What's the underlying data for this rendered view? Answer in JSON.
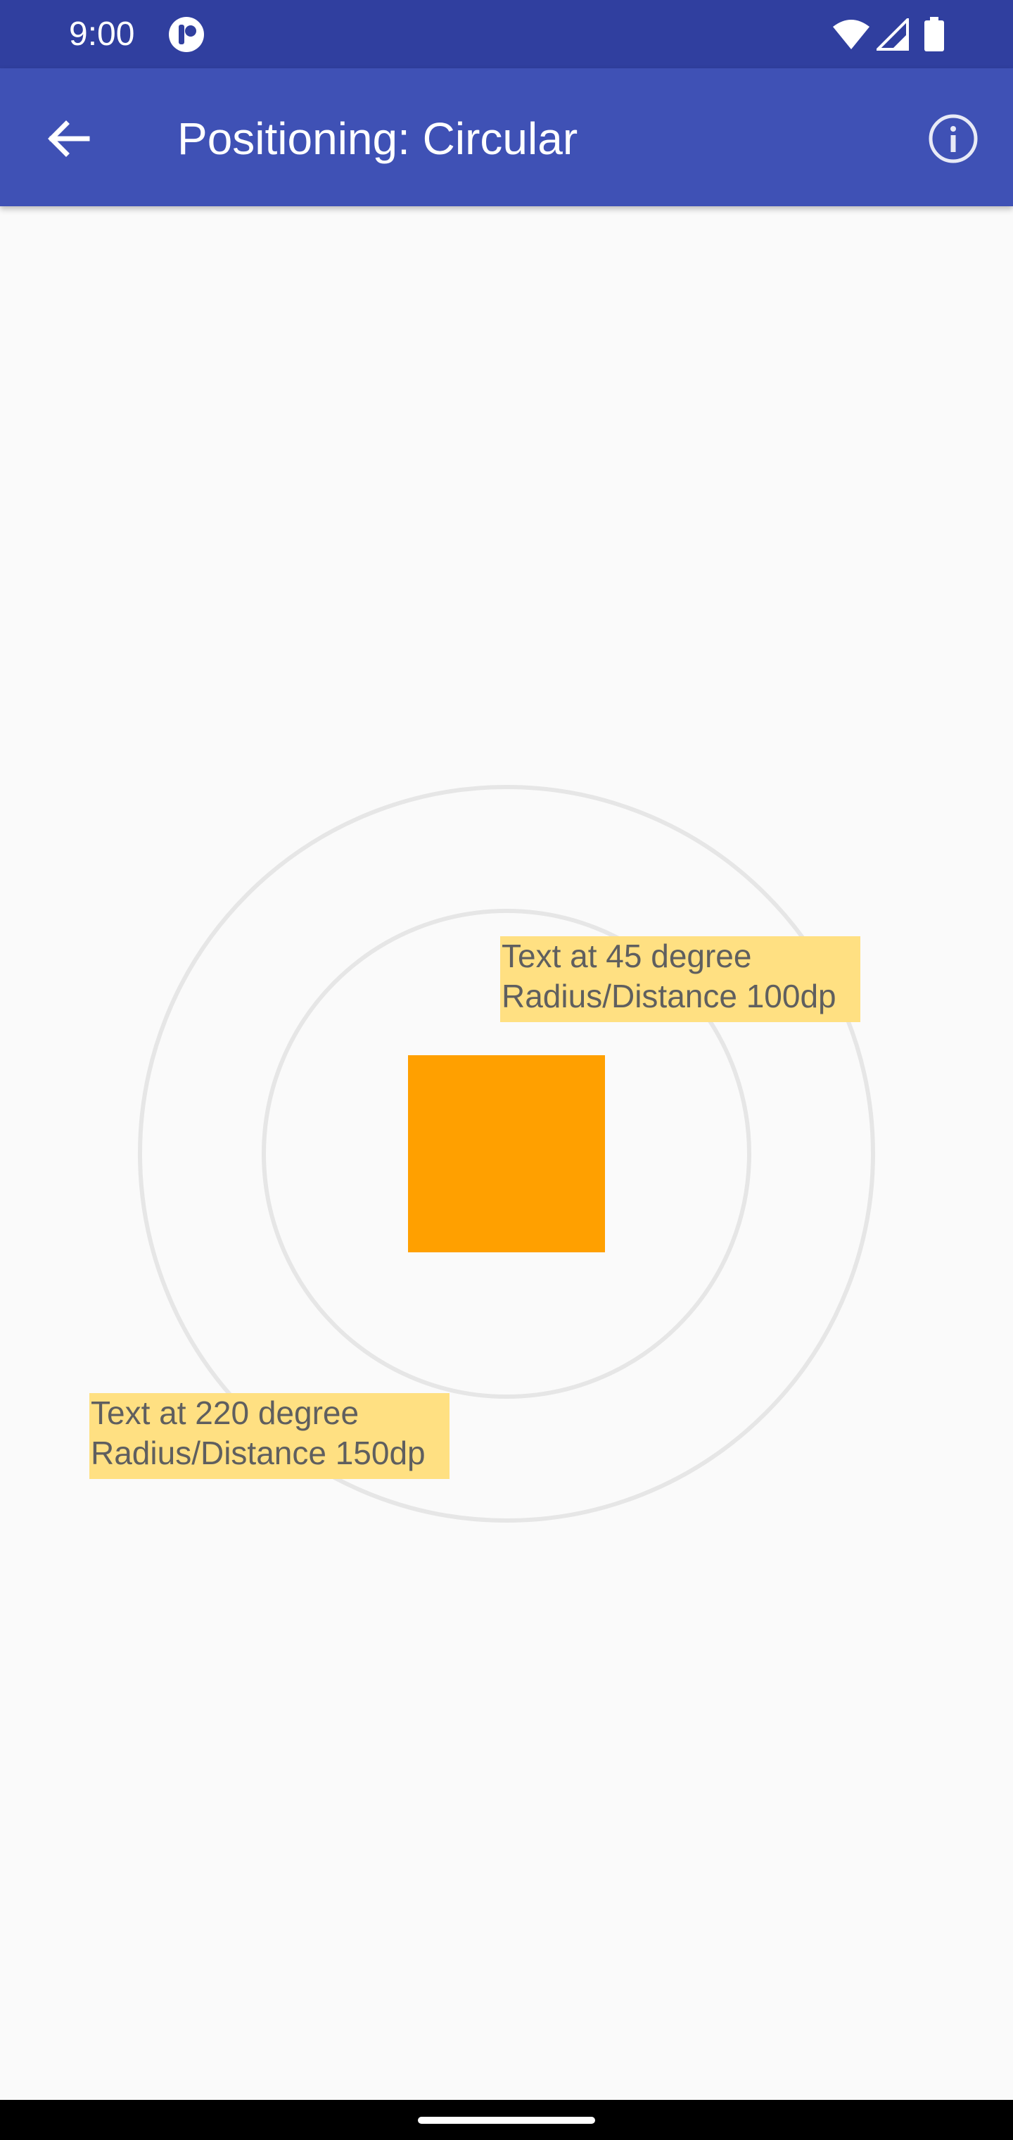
{
  "status_bar": {
    "time": "9:00",
    "icons": [
      "notification-icon",
      "wifi-icon",
      "signal-icon",
      "battery-icon"
    ]
  },
  "app_bar": {
    "title": "Positioning: Circular",
    "back_icon": "arrow-back-icon",
    "info_icon": "info-icon"
  },
  "canvas": {
    "label_45": {
      "line1": "Text at 45 degree",
      "line2": "Radius/Distance 100dp"
    },
    "label_220": {
      "line1": "Text at 220 degree",
      "line2": "Radius/Distance 150dp"
    }
  },
  "colors": {
    "status_bar": "#303f9f",
    "app_bar": "#3f51b5",
    "background": "#fafafa",
    "center_square": "#ffa000",
    "label_background": "#ffe082",
    "guide_circle": "#e6e6e6"
  }
}
